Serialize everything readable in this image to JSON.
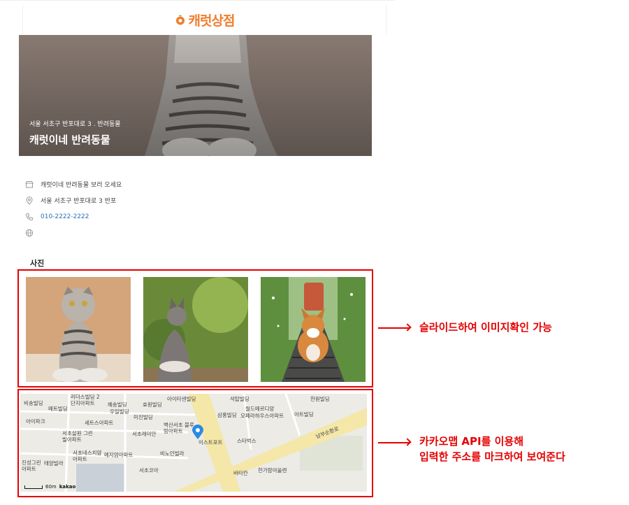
{
  "header": {
    "logo_text": "캐럿상점",
    "logo_icon": "carrot-icon"
  },
  "hero": {
    "subtitle": "서울 서초구 반포대로 3 . 반려동물",
    "title": "캐럿이네 반려동물"
  },
  "info": {
    "description": "캐럿이네 반려동물 보러 오세요",
    "address": "서울 서초구 반포대로 3 반포",
    "phone": "010-2222-2222",
    "icons": [
      "store-icon",
      "location-pin-icon",
      "phone-icon",
      "globe-icon"
    ]
  },
  "photos": {
    "section_title": "사진",
    "items": [
      "scottish-fold-cat-photo",
      "kitten-photo",
      "corgi-photo"
    ]
  },
  "map": {
    "labels": [
      "비송빌딩",
      "리더스빌딩 2단지아파트",
      "혜송빌딩",
      "효원빌딩",
      "아이타센빌딩",
      "석탑빌딩",
      "한원빌딩",
      "메트빌딩",
      "우일빌딩",
      "월드메르디앙",
      "아트빌딩",
      "아이파크",
      "미진빌딩",
      "삼홍빌딩",
      "오페라하우스아파트",
      "세트스아파트",
      "벽산서초 블루밍아파트",
      "서초래미안",
      "이스트포트",
      "스타벅스",
      "서초실원 그린빌아파트",
      "비노인빌라",
      "서초네스치얌 아파트",
      "메지엄아파트",
      "서초코아",
      "진성그린 아파트",
      "태양빌라",
      "바타칸",
      "한가람아울렌",
      "남부순환로"
    ],
    "scale_text": "60m",
    "brand": "kakao",
    "colors": {
      "pin": "#2b8ae2",
      "road": "#f4e7a8"
    }
  },
  "annotations": {
    "slide_note": "슬라이드하여 이미지확인 가능",
    "map_note_line1": "카카오맵 API를 이용해",
    "map_note_line2": "입력한 주소를 마크하여 보여준다"
  },
  "colors": {
    "accent": "#e50000",
    "logo": "#f07d2c"
  }
}
